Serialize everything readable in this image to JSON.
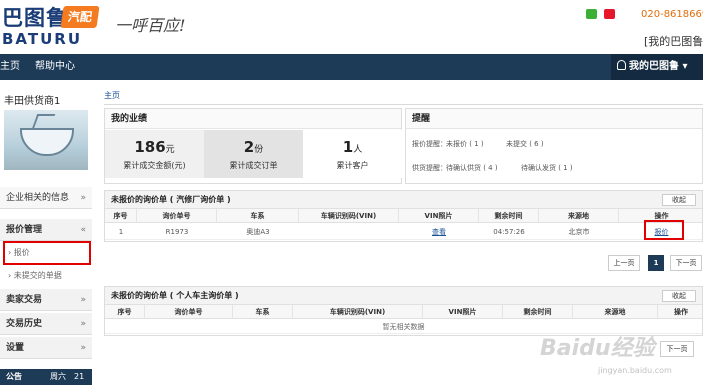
{
  "header": {
    "logo_cn": "巴图鲁",
    "logo_en": "BATURU",
    "logo_mark": "汽配",
    "slogan": "一呼百应!",
    "phone": "020-86186699",
    "my_link": "[我的巴图鲁]"
  },
  "nav": {
    "items": [
      "主页",
      "帮助中心"
    ],
    "user_menu": "我的巴图鲁"
  },
  "sidebar": {
    "company": "丰田供货商1",
    "menu": [
      {
        "label": "企业相关的信息",
        "chevron": "»"
      },
      {
        "label": "报价管理",
        "chevron": "«"
      },
      {
        "label": "卖家交易",
        "chevron": "»"
      },
      {
        "label": "交易历史",
        "chevron": "»"
      },
      {
        "label": "设置",
        "chevron": "»"
      }
    ],
    "sub_items": [
      "报价",
      "未提交的单据"
    ],
    "notice": {
      "label": "公告",
      "weekday": "周六",
      "day": "21"
    }
  },
  "breadcrumb": "主页",
  "performance": {
    "title": "我的业绩",
    "stats": [
      {
        "value": "186",
        "unit": "元",
        "label": "累计成交金额(元)"
      },
      {
        "value": "2",
        "unit": "份",
        "label": "累计成交订单"
      },
      {
        "value": "1",
        "unit": "人",
        "label": "累计客户"
      }
    ]
  },
  "reminders": {
    "title": "提醒",
    "row1": {
      "label": "报价提醒：",
      "a": "未报价 ( 1 )",
      "b": "未提交 ( 6 )"
    },
    "row2": {
      "label": "供货提醒：",
      "a": "待确认供货 ( 4 )",
      "b": "待确认发货 ( 1 )"
    }
  },
  "panel_garage": {
    "title": "未报价的询价单 ( 汽修厂询价单 )",
    "collapse": "收起",
    "columns": [
      "序号",
      "询价单号",
      "车系",
      "车辆识别码(VIN)",
      "VIN照片",
      "剩余时间",
      "来源地",
      "操作"
    ],
    "rows": [
      {
        "no": "1",
        "order": "R1973",
        "series": "奥迪A3",
        "vin": "",
        "photo": "查看",
        "remaining": "04:57:26",
        "origin": "北京市",
        "action": "报价"
      }
    ],
    "pager": {
      "prev": "上一页",
      "page": "1",
      "next": "下一页"
    }
  },
  "panel_personal": {
    "title": "未报价的询价单 ( 个人车主询价单 )",
    "collapse": "收起",
    "columns": [
      "序号",
      "询价单号",
      "车系",
      "车辆识别码(VIN)",
      "VIN照片",
      "剩余时间",
      "来源地",
      "操作"
    ],
    "empty": "暂无相关数据",
    "pager": {
      "next": "下一页"
    }
  },
  "watermark": {
    "main": "Baidu经验",
    "sub": "jingyan.baidu.com"
  },
  "colors": {
    "navbar": "#1d3a57",
    "accent_orange": "#f47b20",
    "highlight_red": "#e00000",
    "link": "#1a4f9a"
  }
}
